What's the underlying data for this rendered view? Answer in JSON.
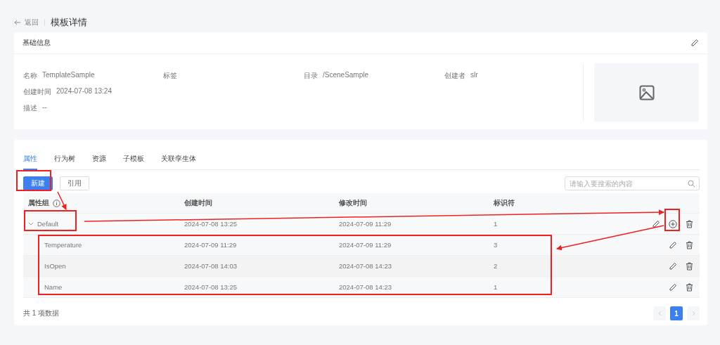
{
  "header": {
    "back": "返回",
    "title": "模板详情"
  },
  "basic_info": {
    "title": "基础信息",
    "rows": [
      [
        {
          "label": "名称",
          "value": "TemplateSample"
        },
        {
          "label": "标签"
        },
        {
          "label": "目录",
          "value": "/SceneSample"
        },
        {
          "label": "创建者",
          "value": "slr"
        }
      ],
      [
        {
          "label": "创建时间",
          "value": "2024-07-08 13:24"
        }
      ],
      [
        {
          "label": "描述",
          "value": "--"
        }
      ]
    ]
  },
  "tabs": [
    {
      "label": "属性",
      "selected": true
    },
    {
      "label": "行为树",
      "selected": false
    },
    {
      "label": "资源",
      "selected": false
    },
    {
      "label": "子模板",
      "selected": false
    },
    {
      "label": "关联孪生体",
      "selected": false
    }
  ],
  "toolbar": {
    "buttons": [
      {
        "label": "新建",
        "kind": "primary"
      },
      {
        "label": "引用",
        "kind": "default"
      }
    ],
    "search": {
      "placeholder": "请输入要搜索的内容"
    }
  },
  "table": {
    "columns": [
      "属性组",
      "创建时间",
      "修改时间",
      "标识符"
    ],
    "rows": [
      {
        "name": "Default",
        "created": "2024-07-08 13:25",
        "modified": "2024-07-09 11:29",
        "identifier": "1",
        "expanded": true,
        "children": [
          {
            "name": "Temperature",
            "created": "2024-07-09 11:29",
            "modified": "2024-07-09 11:29",
            "identifier": "3"
          },
          {
            "name": "IsOpen",
            "created": "2024-07-08 14:03",
            "modified": "2024-07-08 14:23",
            "identifier": "2"
          },
          {
            "name": "Name",
            "created": "2024-07-08 13:25",
            "modified": "2024-07-08 14:23",
            "identifier": "1"
          }
        ]
      }
    ]
  },
  "footer": {
    "total": "共 1 项数据",
    "pages": [
      {
        "label": "1",
        "selected": true
      }
    ]
  }
}
